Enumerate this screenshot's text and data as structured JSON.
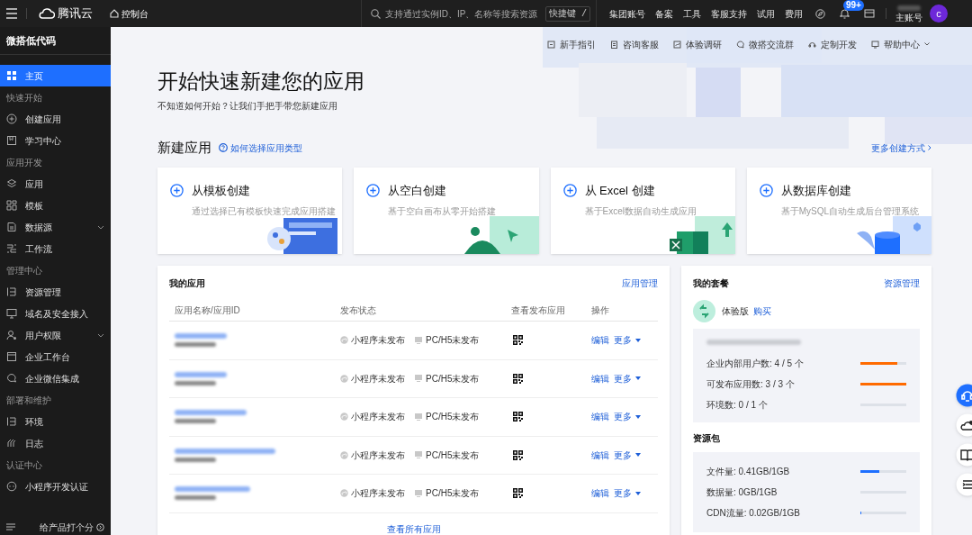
{
  "topbar": {
    "brand": "腾讯云",
    "console": "控制台",
    "search": {
      "placeholder": "支持通过实例ID、IP、名称等搜索资源"
    },
    "shortcut": "快捷键 /",
    "nav": [
      "集团账号",
      "备案",
      "工具",
      "客服支持",
      "试用",
      "费用"
    ],
    "notification_badge": "99+",
    "account_label": "主账号",
    "avatar": "c"
  },
  "sidebar": {
    "title": "微搭低代码",
    "items": [
      {
        "kind": "item",
        "label": "主页",
        "selected": true
      },
      {
        "kind": "header",
        "label": "快速开始"
      },
      {
        "kind": "item",
        "label": "创建应用",
        "selected": false
      },
      {
        "kind": "item",
        "label": "学习中心",
        "selected": false
      },
      {
        "kind": "header",
        "label": "应用开发"
      },
      {
        "kind": "item",
        "label": "应用",
        "selected": false
      },
      {
        "kind": "item",
        "label": "模板",
        "selected": false
      },
      {
        "kind": "item",
        "label": "数据源",
        "selected": false,
        "expandable": true
      },
      {
        "kind": "item",
        "label": "工作流",
        "selected": false
      },
      {
        "kind": "header",
        "label": "管理中心"
      },
      {
        "kind": "item",
        "label": "资源管理",
        "selected": false
      },
      {
        "kind": "item",
        "label": "域名及安全接入",
        "selected": false
      },
      {
        "kind": "item",
        "label": "用户权限",
        "selected": false,
        "expandable": true
      },
      {
        "kind": "item",
        "label": "企业工作台",
        "selected": false
      },
      {
        "kind": "item",
        "label": "企业微信集成",
        "selected": false
      },
      {
        "kind": "header",
        "label": "部署和维护"
      },
      {
        "kind": "item",
        "label": "环境",
        "selected": false
      },
      {
        "kind": "item",
        "label": "日志",
        "selected": false
      },
      {
        "kind": "header",
        "label": "认证中心"
      },
      {
        "kind": "item",
        "label": "小程序开发认证",
        "selected": false
      }
    ],
    "feedback": "给产品打个分"
  },
  "helpbar": [
    "新手指引",
    "咨询客服",
    "体验调研",
    "微搭交流群",
    "定制开发",
    "帮助中心"
  ],
  "hero": {
    "title": "开始快速新建您的应用",
    "subtitle": "不知道如何开始？让我们手把手带您新建应用"
  },
  "create": {
    "title": "新建应用",
    "help": "如何选择应用类型",
    "more": "更多创建方式",
    "cards": [
      {
        "title": "从模板创建",
        "desc": "通过选择已有模板快速完成应用搭建"
      },
      {
        "title": "从空白创建",
        "desc": "基于空白画布从零开始搭建"
      },
      {
        "title": "从 Excel 创建",
        "desc": "基于Excel数据自动生成应用"
      },
      {
        "title": "从数据库创建",
        "desc": "基于MySQL自动生成后台管理系统"
      }
    ]
  },
  "my_apps": {
    "title": "我的应用",
    "manage": "应用管理",
    "columns": [
      "应用名称/应用ID",
      "发布状态",
      "查看发布应用",
      "操作"
    ],
    "rows": [
      {
        "miniprogram": "小程序未发布",
        "web": "PC/H5未发布",
        "edit": "编辑",
        "more": "更多"
      },
      {
        "miniprogram": "小程序未发布",
        "web": "PC/H5未发布",
        "edit": "编辑",
        "more": "更多"
      },
      {
        "miniprogram": "小程序未发布",
        "web": "PC/H5未发布",
        "edit": "编辑",
        "more": "更多"
      },
      {
        "miniprogram": "小程序未发布",
        "web": "PC/H5未发布",
        "edit": "编辑",
        "more": "更多"
      },
      {
        "miniprogram": "小程序未发布",
        "web": "PC/H5未发布",
        "edit": "编辑",
        "more": "更多"
      }
    ],
    "view_all": "查看所有应用"
  },
  "package": {
    "title": "我的套餐",
    "manage": "资源管理",
    "plan": "体验版",
    "buy": "购买",
    "quotas": [
      {
        "label": "企业内部用户数: 4 / 5 个",
        "level": 0.8
      },
      {
        "label": "可发布应用数: 3 / 3 个",
        "level": 1
      },
      {
        "label": "环境数: 0 / 1 个",
        "level": 0
      }
    ],
    "resource_title": "资源包",
    "resources": [
      {
        "label": "文件量: 0.41GB/1GB",
        "level": 0.41
      },
      {
        "label": "数据量: 0GB/1GB",
        "level": 0
      },
      {
        "label": "CDN流量: 0.02GB/1GB",
        "level": 0.02
      }
    ]
  }
}
